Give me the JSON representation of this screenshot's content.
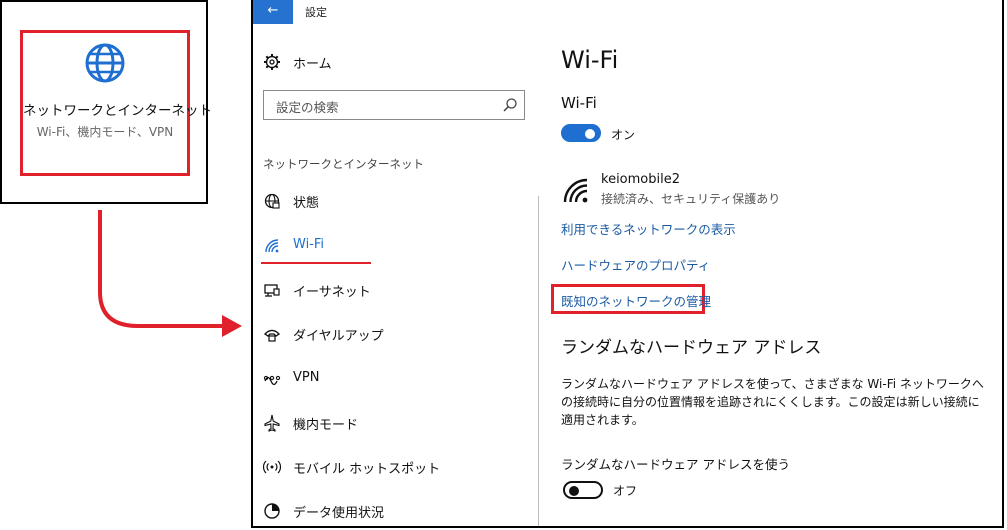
{
  "thumbnail": {
    "title": "ネットワークとインターネット",
    "subtitle": "Wi-Fi、機内モード、VPN"
  },
  "window": {
    "back_label": "←",
    "app_title": "設定"
  },
  "sidebar": {
    "home_label": "ホーム",
    "search_placeholder": "設定の検索",
    "section_label": "ネットワークとインターネット",
    "items": [
      {
        "label": "状態",
        "icon": "globe-status-icon"
      },
      {
        "label": "Wi-Fi",
        "icon": "wifi-icon",
        "selected": true
      },
      {
        "label": "イーサネット",
        "icon": "ethernet-icon"
      },
      {
        "label": "ダイヤルアップ",
        "icon": "phone-icon"
      },
      {
        "label": "VPN",
        "icon": "vpn-icon"
      },
      {
        "label": "機内モード",
        "icon": "airplane-icon"
      },
      {
        "label": "モバイル ホットスポット",
        "icon": "hotspot-icon"
      },
      {
        "label": "データ使用状況",
        "icon": "data-usage-icon"
      }
    ],
    "accent_color": "#e0202a"
  },
  "main": {
    "page_title": "Wi-Fi",
    "wifi_heading": "Wi-Fi",
    "wifi_toggle": {
      "state_text": "オン",
      "on": true
    },
    "network": {
      "name": "keiomobile2",
      "status": "接続済み、セキュリティ保護あり"
    },
    "links": {
      "available": "利用できるネットワークの表示",
      "hardware": "ハードウェアのプロパティ",
      "known": "既知のネットワークの管理"
    },
    "random": {
      "heading": "ランダムなハードウェア アドレス",
      "description": "ランダムなハードウェア アドレスを使って、さまざまな Wi-Fi ネットワークへの接続時に自分の位置情報を追跡されにくくします。この設定は新しい接続に適用されます。",
      "use_label": "ランダムなハードウェア アドレスを使う",
      "toggle": {
        "state_text": "オフ",
        "on": false
      }
    },
    "accent_color": "#1f6fd1",
    "link_color": "#1a5aa3"
  }
}
